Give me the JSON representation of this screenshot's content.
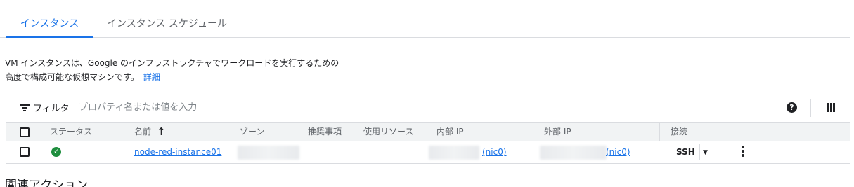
{
  "tabs": [
    {
      "label": "インスタンス",
      "active": true
    },
    {
      "label": "インスタンス スケジュール",
      "active": false
    }
  ],
  "description": {
    "line1": "VM インスタンスは、Google のインフラストラクチャでワークロードを実行するための",
    "line2": "高度で構成可能な仮想マシンです。",
    "link": "詳細"
  },
  "filter": {
    "label": "フィルタ",
    "placeholder": "プロパティ名または値を入力",
    "icon": "filter-list-icon",
    "help_icon": "help-icon",
    "columns_icon": "column-display-icon"
  },
  "table": {
    "columns": {
      "status": "ステータス",
      "name": "名前",
      "zone": "ゾーン",
      "recommendation": "推奨事項",
      "in_use_by": "使用リソース",
      "internal_ip": "内部 IP",
      "external_ip": "外部 IP",
      "connect": "接続"
    },
    "sort_indicator": "↑",
    "rows": [
      {
        "status_icon": "check-circle-icon",
        "name": "node-red-instance01",
        "internal_ip_nic": "(nic0)",
        "external_ip_nic": "(nic0)",
        "connect": "SSH"
      }
    ]
  },
  "related": {
    "title": "関連アクション"
  },
  "colors": {
    "accent": "#1a73e8",
    "status_ok": "#1e8e3e",
    "header_bg": "#f1f3f4",
    "border": "#dadce0"
  }
}
